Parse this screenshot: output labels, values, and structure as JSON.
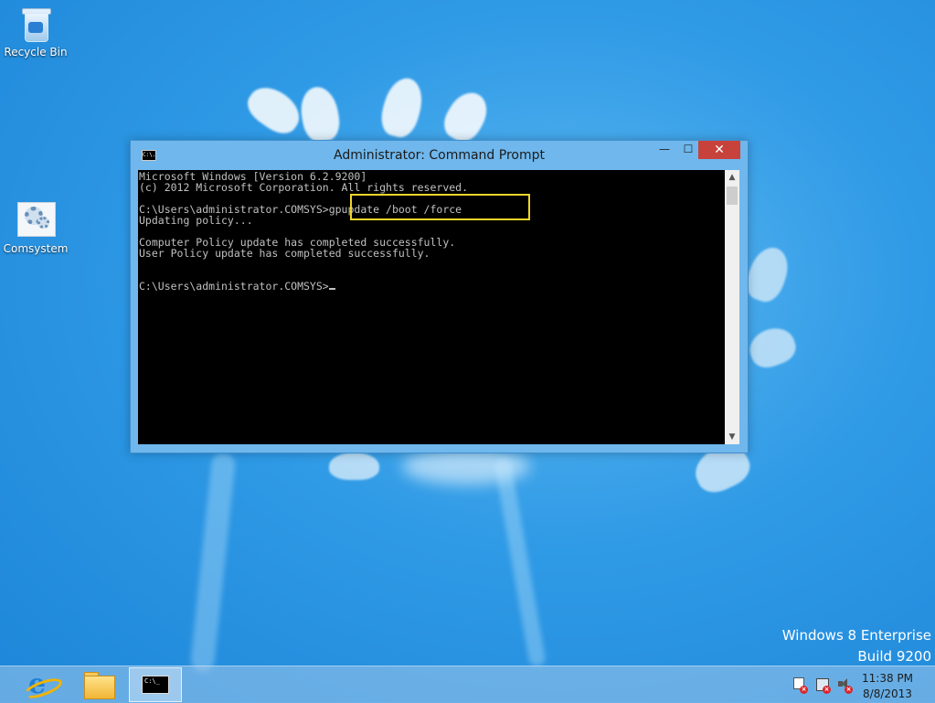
{
  "desktop": {
    "icons": [
      {
        "label": "Recycle Bin"
      },
      {
        "label": "Comsystem"
      }
    ],
    "watermark": {
      "line1": "Windows 8 Enterprise",
      "line2": "Build 9200"
    }
  },
  "window": {
    "title": "Administrator: Command Prompt",
    "icon_text": "C:\\.",
    "controls": {
      "minimize": "—",
      "maximize": "☐",
      "close": "✕"
    },
    "console_lines": [
      "Microsoft Windows [Version 6.2.9200]",
      "(c) 2012 Microsoft Corporation. All rights reserved.",
      "",
      "C:\\Users\\administrator.COMSYS>gpupdate /boot /force",
      "Updating policy...",
      "",
      "Computer Policy update has completed successfully.",
      "User Policy update has completed successfully.",
      "",
      "",
      "C:\\Users\\administrator.COMSYS>"
    ],
    "highlight_color": "#f0d52a"
  },
  "taskbar": {
    "pinned": [
      {
        "name": "internet-explorer",
        "icon": "ie-icon"
      },
      {
        "name": "file-explorer",
        "icon": "folder-icon"
      },
      {
        "name": "command-prompt",
        "icon": "cmd-icon",
        "icon_text": "C:\\_"
      }
    ],
    "clock": {
      "time": "11:38 PM",
      "date": "8/8/2013"
    }
  },
  "colors": {
    "desktop_bg": "#2f9ae6",
    "window_frame": "#6fb7ec",
    "close_button": "#c7423b"
  }
}
